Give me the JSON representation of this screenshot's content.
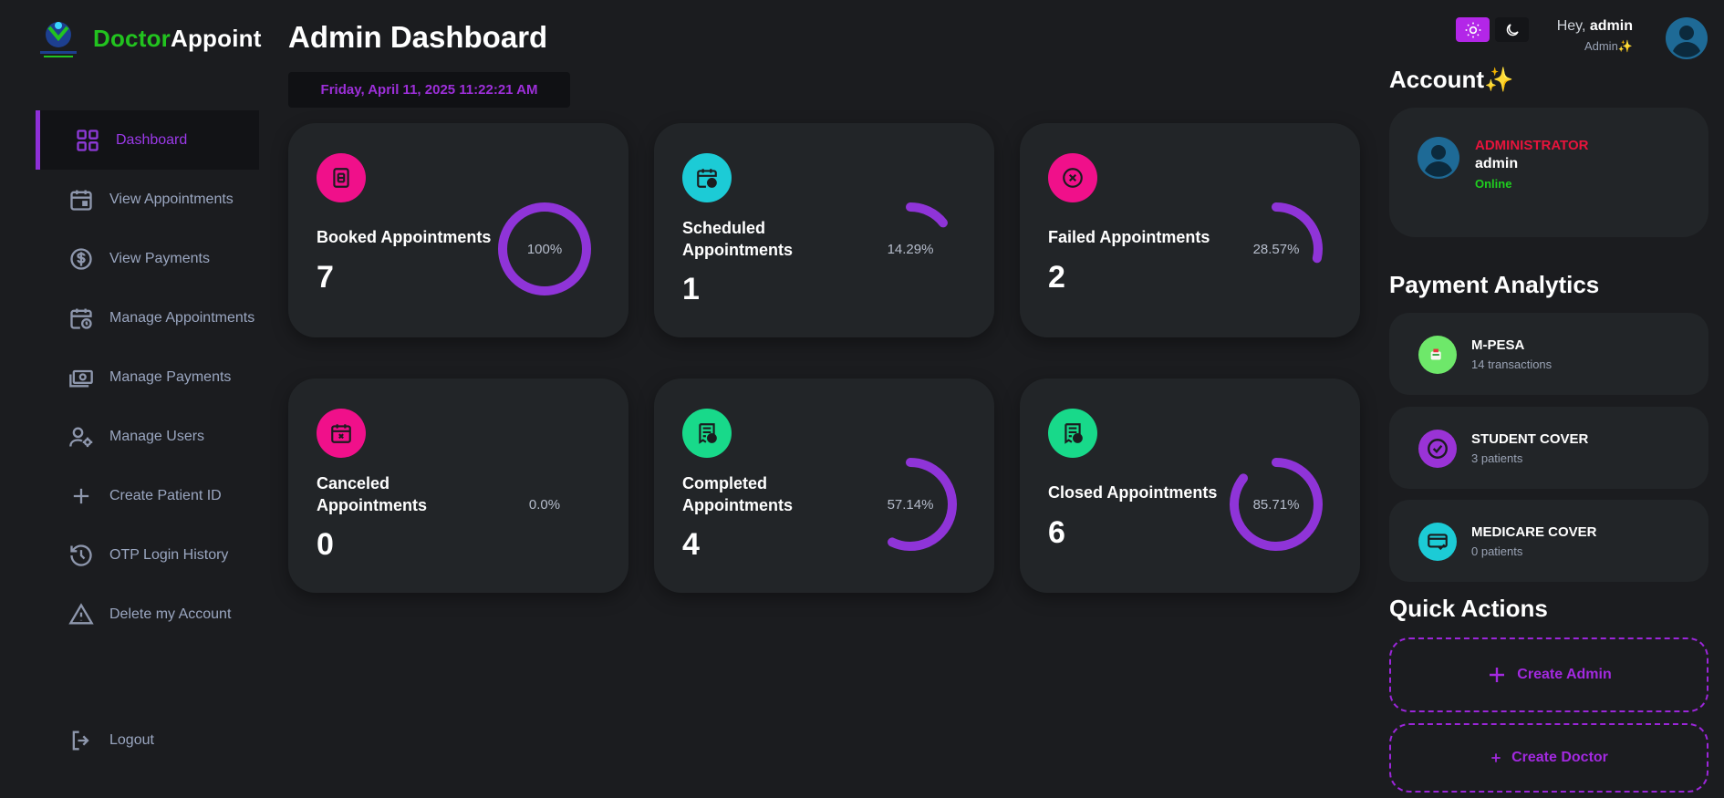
{
  "brand": {
    "part1": "Doctor",
    "part2": "Appoint"
  },
  "sidebar": {
    "items": [
      {
        "label": "Dashboard",
        "icon": "grid-icon",
        "active": true
      },
      {
        "label": "View Appointments",
        "icon": "calendar-icon"
      },
      {
        "label": "View Payments",
        "icon": "dollar-circle-icon"
      },
      {
        "label": "Manage Appointments",
        "icon": "calendar-clock-icon"
      },
      {
        "label": "Manage Payments",
        "icon": "banknote-icon"
      },
      {
        "label": "Manage Users",
        "icon": "users-gear-icon"
      },
      {
        "label": "Create Patient ID",
        "icon": "plus-icon"
      },
      {
        "label": "OTP Login History",
        "icon": "history-icon"
      },
      {
        "label": "Delete my Account",
        "icon": "warning-icon"
      }
    ],
    "logout": "Logout"
  },
  "header": {
    "title": "Admin Dashboard",
    "datetime": "Friday, April 11, 2025 11:22:21 AM",
    "greeting_prefix": "Hey, ",
    "username": "admin",
    "role_label": "Admin✨"
  },
  "stats": [
    {
      "title": "Booked Appointments",
      "value": "7",
      "percent": "100%",
      "fraction": 1.0,
      "icon": "document-icon",
      "icon_color": "#f0108a"
    },
    {
      "title": "Scheduled Appointments",
      "value": "1",
      "percent": "14.29%",
      "fraction": 0.1429,
      "icon": "calendar-clock-icon",
      "icon_color": "#1ccbd6"
    },
    {
      "title": "Failed Appointments",
      "value": "2",
      "percent": "28.57%",
      "fraction": 0.2857,
      "icon": "x-circle-icon",
      "icon_color": "#f0108a"
    },
    {
      "title": "Canceled Appointments",
      "value": "0",
      "percent": "0.0%",
      "fraction": 0.0,
      "icon": "calendar-x-icon",
      "icon_color": "#f0108a"
    },
    {
      "title": "Completed Appointments",
      "value": "4",
      "percent": "57.14%",
      "fraction": 0.5714,
      "icon": "receipt-check-icon",
      "icon_color": "#18d98a"
    },
    {
      "title": "Closed Appointments",
      "value": "6",
      "percent": "85.71%",
      "fraction": 0.8571,
      "icon": "receipt-check-icon",
      "icon_color": "#18d98a"
    }
  ],
  "account": {
    "title": "Account✨",
    "role": "ADMINISTRATOR",
    "name": "admin",
    "status": "Online"
  },
  "payment_analytics": {
    "title": "Payment Analytics",
    "items": [
      {
        "name": "M-PESA",
        "sub": "14 transactions",
        "icon": "mpesa-logo-icon",
        "color": "#6ee86a"
      },
      {
        "name": "STUDENT COVER",
        "sub": "3 patients",
        "icon": "check-circle-icon",
        "color": "#9a33d6"
      },
      {
        "name": "MEDICARE COVER",
        "sub": "0 patients",
        "icon": "card-check-icon",
        "color": "#1ccbd6"
      }
    ]
  },
  "quick_actions": {
    "title": "Quick Actions",
    "create_admin": "Create Admin",
    "create_doctor": "Create Doctor"
  },
  "colors": {
    "accent": "#9b2fe0",
    "ring": "#8f34d8",
    "background": "#1b1c1f",
    "card": "#222528"
  }
}
